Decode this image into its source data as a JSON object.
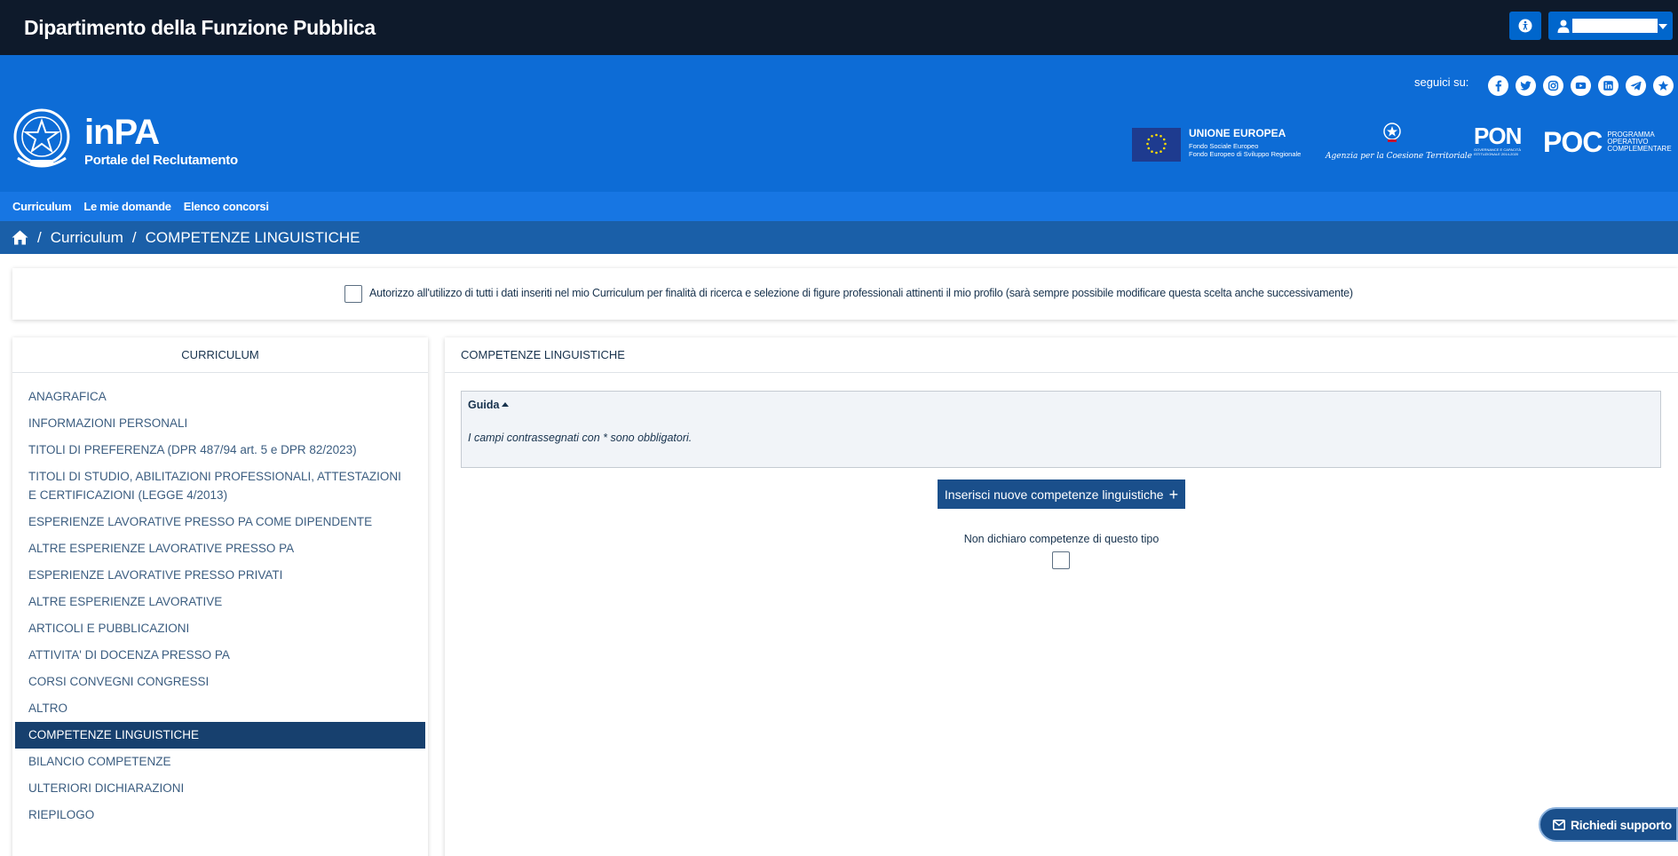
{
  "topbar": {
    "title": "Dipartimento della Funzione Pubblica"
  },
  "header": {
    "brand_name": "inPA",
    "brand_subtitle": "Portale del Reclutamento",
    "seguici": "seguici su:",
    "socials": [
      "facebook-icon",
      "twitter-icon",
      "instagram-icon",
      "youtube-icon",
      "linkedin-icon",
      "telegram-icon",
      "star-icon"
    ],
    "eu_title": "UNIONE EUROPEA",
    "eu_line1": "Fondo Sociale Europeo",
    "eu_line2": "Fondo Europeo di Sviluppo Regionale",
    "agenzia": "Agenzia per la Coesione Territoriale",
    "pon": "PON",
    "pon_sub": "GOVERNANCE E CAPACITÀ ISTITUZIONALE 2014-2020",
    "poc": "POC",
    "poc_sub": "PROGRAMMA OPERATIVO COMPLEMENTARE"
  },
  "nav": {
    "items": [
      "Curriculum",
      "Le mie domande",
      "Elenco concorsi"
    ]
  },
  "breadcrumb": {
    "items": [
      "Curriculum",
      "COMPETENZE LINGUISTICHE"
    ]
  },
  "consent": {
    "text": "Autorizzo all'utilizzo di tutti i dati inseriti nel mio Curriculum per finalità di ricerca e selezione di figure professionali attinenti il mio profilo (sarà sempre possibile modificare questa scelta anche successivamente)"
  },
  "sidebar": {
    "title": "CURRICULUM",
    "items": [
      "ANAGRAFICA",
      "INFORMAZIONI PERSONALI",
      "TITOLI DI PREFERENZA (DPR 487/94 art. 5 e DPR 82/2023)",
      "TITOLI DI STUDIO, ABILITAZIONI PROFESSIONALI, ATTESTAZIONI E CERTIFICAZIONI (LEGGE 4/2013)",
      "ESPERIENZE LAVORATIVE PRESSO PA COME DIPENDENTE",
      "ALTRE ESPERIENZE LAVORATIVE PRESSO PA",
      "ESPERIENZE LAVORATIVE PRESSO PRIVATI",
      "ALTRE ESPERIENZE LAVORATIVE",
      "ARTICOLI E PUBBLICAZIONI",
      "ATTIVITA' DI DOCENZA PRESSO PA",
      "CORSI CONVEGNI CONGRESSI",
      "ALTRO",
      "COMPETENZE LINGUISTICHE",
      "BILANCIO COMPETENZE",
      "ULTERIORI DICHIARAZIONI",
      "RIEPILOGO"
    ],
    "active_index": 12
  },
  "main": {
    "title": "COMPETENZE LINGUISTICHE",
    "guida_title": "Guida",
    "guida_text": "I campi contrassegnati con * sono obbligatori.",
    "insert_button": "Inserisci nuove competenze linguistiche",
    "non_dichiaro": "Non dichiaro competenze di questo tipo"
  },
  "support": {
    "label": "Richiedi supporto"
  },
  "colors": {
    "topbar": "#0e1a2b",
    "header": "#0d6cd6",
    "nav": "#1776e3",
    "breadcrumb": "#1a5fa8",
    "active": "#17406e",
    "button": "#1a4f8b"
  }
}
